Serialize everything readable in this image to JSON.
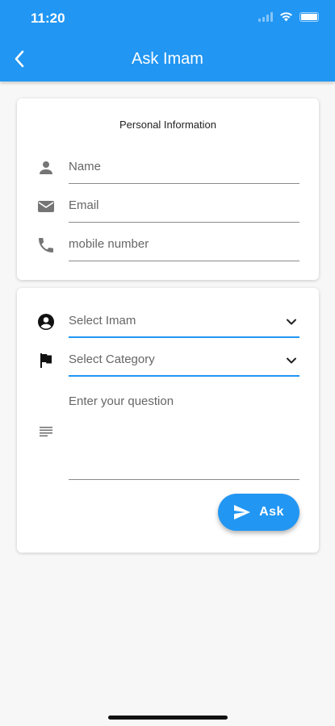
{
  "status_bar": {
    "time": "11:20"
  },
  "app_bar": {
    "title": "Ask Imam",
    "back_icon": "chevron-left-icon"
  },
  "personal_info": {
    "title": "Personal Information",
    "fields": [
      {
        "icon": "person-icon",
        "placeholder": "Name"
      },
      {
        "icon": "mail-icon",
        "placeholder": "Email"
      },
      {
        "icon": "phone-icon",
        "placeholder": "mobile number"
      }
    ]
  },
  "question_form": {
    "imam_select": {
      "icon": "account-circle-icon",
      "value": "Select Imam"
    },
    "category_select": {
      "icon": "flag-icon",
      "value": "Select Category"
    },
    "question": {
      "icon": "notes-icon",
      "placeholder": "Enter your question"
    },
    "ask_button": {
      "label": "Ask",
      "icon": "send-icon"
    }
  },
  "colors": {
    "primary": "#2196f3",
    "background": "#f7f7f7",
    "icon": "#757575"
  }
}
